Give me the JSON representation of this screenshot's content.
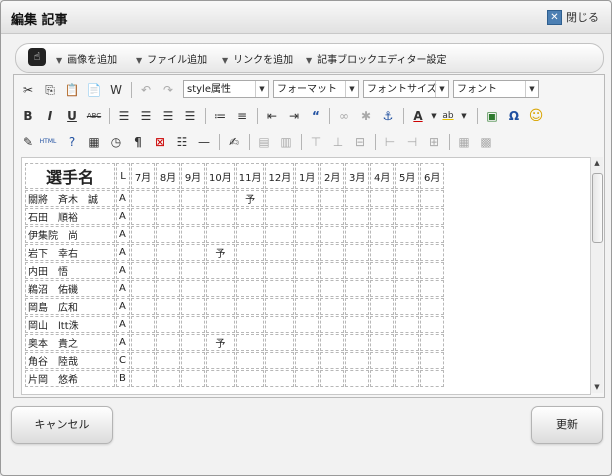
{
  "dialog": {
    "title": "編集 記事",
    "close_label": "閉じる"
  },
  "menubar": {
    "items": [
      {
        "label": "画像を追加",
        "icon": "triangle-down-icon"
      },
      {
        "label": "ファイル追加",
        "icon": "triangle-down-icon"
      },
      {
        "label": "リンクを追加",
        "icon": "triangle-down-icon"
      },
      {
        "label": "記事ブロックエディター設定",
        "icon": "triangle-down-icon"
      }
    ]
  },
  "toolbar": {
    "style_select": "style属性",
    "format_select": "フォーマット",
    "fontsize_select": "フォントサイズ",
    "font_select": "フォント",
    "html_label": "HTML",
    "abc_label": "ABC",
    "ab_label": "ab"
  },
  "table": {
    "header": [
      "選手名",
      "L",
      "7月",
      "8月",
      "9月",
      "10月",
      "11月",
      "12月",
      "1月",
      "2月",
      "3月",
      "4月",
      "5月",
      "6月"
    ],
    "rows": [
      {
        "name": "關將　斉木　誠",
        "l": "A",
        "marks": [
          "",
          "",
          "",
          "",
          "予",
          "",
          "",
          "",
          "",
          "",
          "",
          ""
        ]
      },
      {
        "name": "石田　順裕",
        "l": "A",
        "marks": [
          "",
          "",
          "",
          "",
          "",
          "",
          "",
          "",
          "",
          "",
          "",
          ""
        ]
      },
      {
        "name": "伊集院　尚",
        "l": "A",
        "marks": [
          "",
          "",
          "",
          "",
          "",
          "",
          "",
          "",
          "",
          "",
          "",
          ""
        ]
      },
      {
        "name": "岩下　幸右",
        "l": "A",
        "marks": [
          "",
          "",
          "",
          "予",
          "",
          "",
          "",
          "",
          "",
          "",
          "",
          ""
        ]
      },
      {
        "name": "内田　悟",
        "l": "A",
        "marks": [
          "",
          "",
          "",
          "",
          "",
          "",
          "",
          "",
          "",
          "",
          "",
          ""
        ]
      },
      {
        "name": "鵜沼　佑磯",
        "l": "A",
        "marks": [
          "",
          "",
          "",
          "",
          "",
          "",
          "",
          "",
          "",
          "",
          "",
          ""
        ]
      },
      {
        "name": "岡島　広和",
        "l": "A",
        "marks": [
          "",
          "",
          "",
          "",
          "",
          "",
          "",
          "",
          "",
          "",
          "",
          ""
        ]
      },
      {
        "name": "岡山　ltt洙",
        "l": "A",
        "marks": [
          "",
          "",
          "",
          "",
          "",
          "",
          "",
          "",
          "",
          "",
          "",
          ""
        ]
      },
      {
        "name": "奥本　貴之",
        "l": "A",
        "marks": [
          "",
          "",
          "",
          "予",
          "",
          "",
          "",
          "",
          "",
          "",
          "",
          ""
        ]
      },
      {
        "name": "角谷　陸哉",
        "l": "C",
        "marks": [
          "",
          "",
          "",
          "",
          "",
          "",
          "",
          "",
          "",
          "",
          "",
          ""
        ]
      },
      {
        "name": "片岡　悠希",
        "l": "B",
        "marks": [
          "",
          "",
          "",
          "",
          "",
          "",
          "",
          "",
          "",
          "",
          "",
          ""
        ]
      }
    ]
  },
  "buttons": {
    "cancel": "キャンセル",
    "update": "更新"
  }
}
